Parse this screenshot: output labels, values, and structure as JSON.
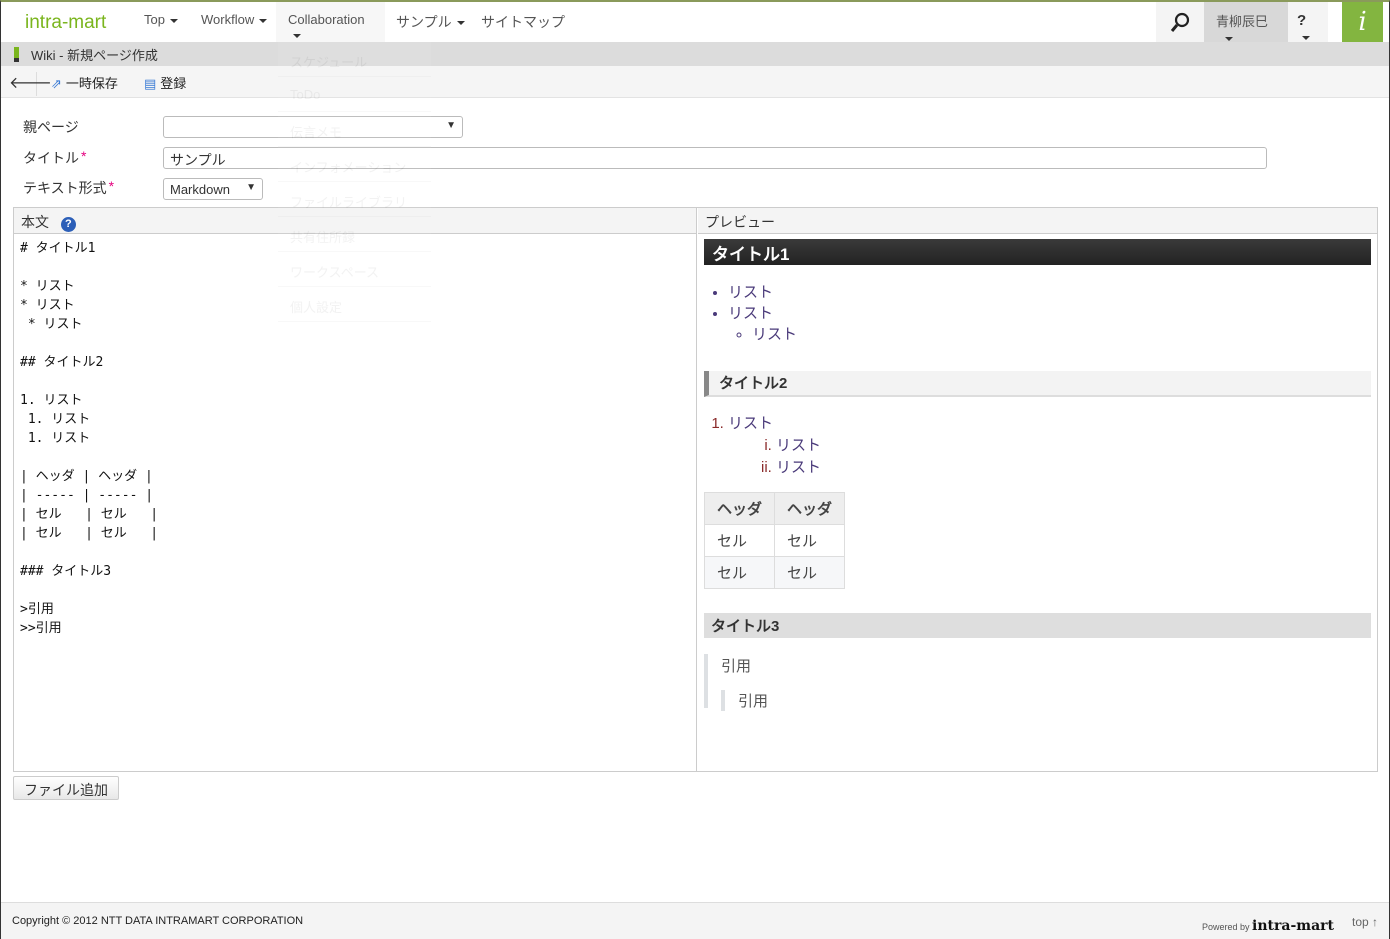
{
  "header": {
    "logo": "intra-mart",
    "nav": [
      {
        "label": "Top"
      },
      {
        "label": "Workflow"
      },
      {
        "label": "Collaboration"
      },
      {
        "label": "サンプル"
      },
      {
        "label": "サイトマップ"
      }
    ],
    "user": "青柳辰巳",
    "help": "?",
    "brand_icon": "i"
  },
  "menu": [
    "スケジュール",
    "ToDo",
    "伝言メモ",
    "インフォメーション",
    "ファイルライブラリ",
    "共有住所録",
    "ワークスペース",
    "個人設定"
  ],
  "title_bar": "Wiki - 新規ページ作成",
  "toolbar": {
    "save_temp": "一時保存",
    "register": "登録"
  },
  "form": {
    "parent_label": "親ページ",
    "parent_value": "",
    "title_label": "タイトル",
    "title_value": "サンプル",
    "format_label": "テキスト形式",
    "format_value": "Markdown",
    "required_mark": "*"
  },
  "editor": {
    "header": "本文",
    "lines": [
      "# タイトル1",
      "",
      "* リスト",
      "* リスト",
      " * リスト",
      "",
      "## タイトル2",
      "",
      "1. リスト",
      " 1. リスト",
      " 1. リスト",
      "",
      "| ヘッダ | ヘッダ |",
      "| ----- | ----- |",
      "| セル   | セル   |",
      "| セル   | セル   |",
      "",
      "### タイトル3",
      "",
      ">引用",
      ">>引用"
    ]
  },
  "preview": {
    "header": "プレビュー",
    "h1": "タイトル1",
    "ul": [
      "リスト",
      "リスト"
    ],
    "ul_nested": "リスト",
    "h2": "タイトル2",
    "ol": "リスト",
    "ol_nested": [
      "リスト",
      "リスト"
    ],
    "table": {
      "headers": [
        "ヘッダ",
        "ヘッダ"
      ],
      "rows": [
        [
          "セル",
          "セル"
        ],
        [
          "セル",
          "セル"
        ]
      ]
    },
    "h3": "タイトル3",
    "quote": "引用",
    "quote_nested": "引用"
  },
  "file_button": "ファイル追加",
  "footer": {
    "copyright": "Copyright © 2012 NTT DATA INTRAMART CORPORATION",
    "powered_by": "Powered by",
    "powered_logo": "intra-mart",
    "top": "top ↑"
  }
}
